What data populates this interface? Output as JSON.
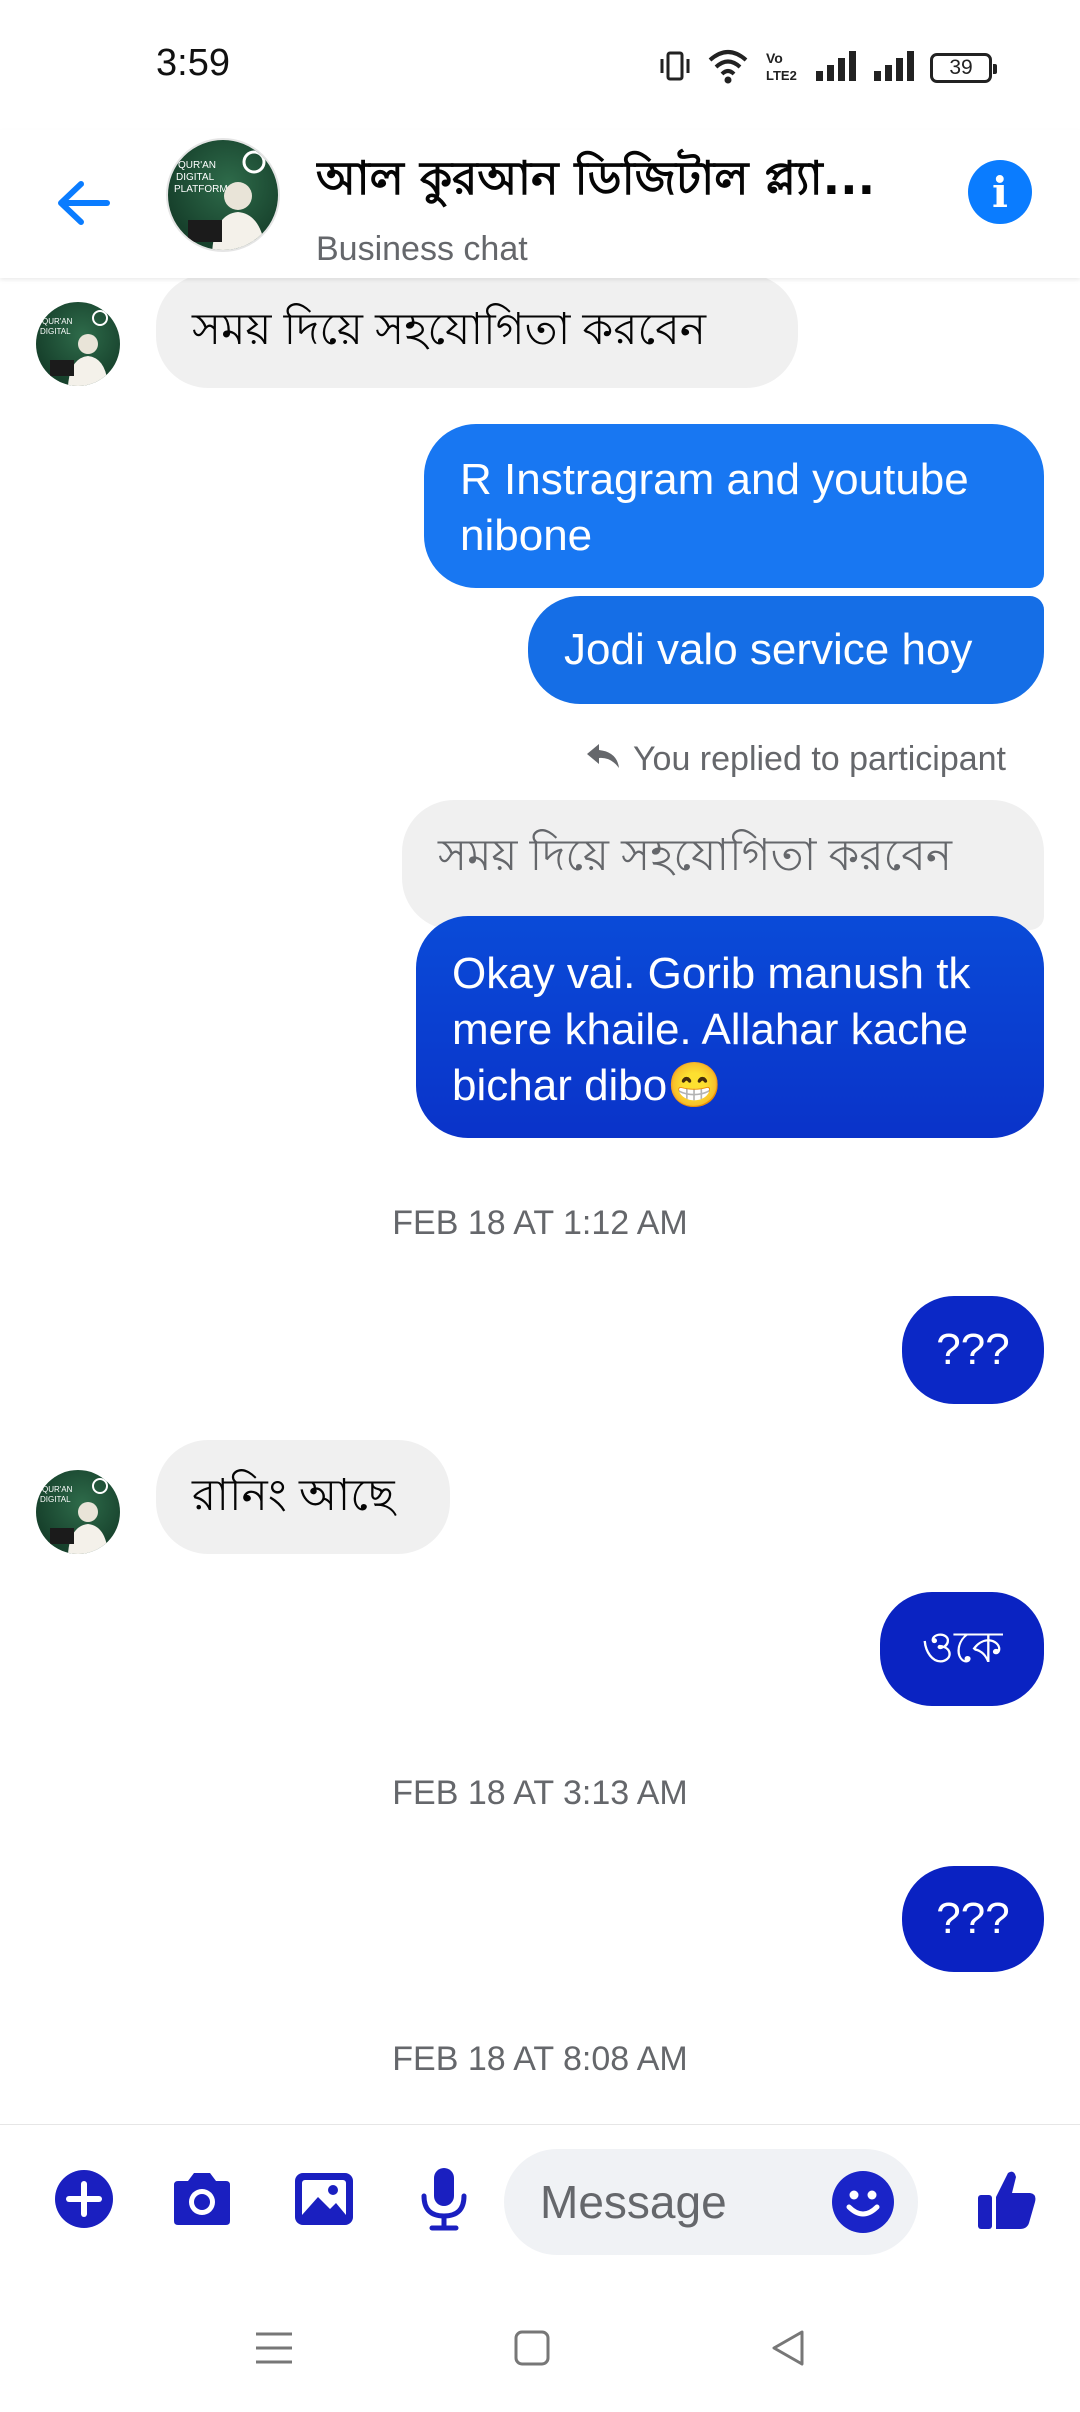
{
  "status_bar": {
    "time": "3:59",
    "battery": "39",
    "network_label": "Vo LTE2"
  },
  "header": {
    "title": "আল কুরআন ডিজিটাল প্ল্যা...",
    "subtitle": "Business chat"
  },
  "messages": {
    "m1": "সময় দিয়ে সহযোগিতা করবেন",
    "m2": "R Instragram and youtube nibone",
    "m3": "Jodi valo service hoy",
    "reply_label": "You replied to participant",
    "quoted": "সময় দিয়ে সহযোগিতা করবেন",
    "m4": "Okay vai. Gorib manush tk mere khaile. Allahar kache bichar dibo😁",
    "ts1": "FEB 18 AT 1:12 AM",
    "m5": "???",
    "m6": "রানিং আছে",
    "m7": "ওকে",
    "ts2": "FEB 18 AT 3:13 AM",
    "m8": "???",
    "ts3": "FEB 18 AT 8:08 AM"
  },
  "composer": {
    "placeholder": "Message"
  },
  "colors": {
    "accent": "#0a7cff",
    "composer_icon": "#1a1fc0",
    "outgoing_top": "#1877f2",
    "outgoing_bottom": "#0a25c7",
    "incoming": "#f0f0f0"
  },
  "icons": {
    "back": "arrow-left-icon",
    "info": "info-icon",
    "add": "plus-circle-icon",
    "camera": "camera-icon",
    "gallery": "image-icon",
    "mic": "microphone-icon",
    "emoji": "smiley-icon",
    "like": "thumbs-up-icon",
    "reply": "reply-arrow-icon"
  }
}
